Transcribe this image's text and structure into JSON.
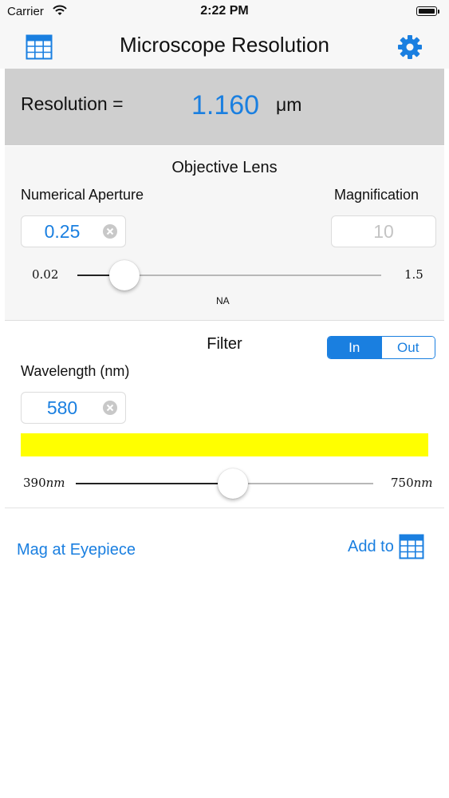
{
  "status_bar": {
    "carrier": "Carrier",
    "time": "2:22 PM",
    "battery_level": 1.0
  },
  "nav": {
    "title": "Microscope Resolution",
    "left_icon": "table-icon",
    "right_icon": "gear-icon"
  },
  "result": {
    "label": "Resolution =",
    "value": "1.160",
    "unit": "μm"
  },
  "objective_lens": {
    "title": "Objective Lens",
    "na_label": "Numerical Aperture",
    "na_value": "0.25",
    "magnification_label": "Magnification",
    "magnification_value": "10",
    "slider": {
      "min_label": "0.02",
      "max_label": "1.5",
      "caption": "NA",
      "min": 0.02,
      "max": 1.5,
      "value": 0.25
    }
  },
  "filter": {
    "title": "Filter",
    "segments": [
      "In",
      "Out"
    ],
    "selected_segment": "In",
    "wavelength_label": "Wavelength (nm)",
    "wavelength_value": "580",
    "swatch_color": "#ffff00",
    "slider": {
      "min_number": "390",
      "max_number": "750",
      "unit": "nm",
      "min": 390,
      "max": 750,
      "value": 580
    }
  },
  "bottom": {
    "mag_link": "Mag at Eyepiece",
    "add_to_label": "Add to",
    "add_to_icon": "table-icon"
  },
  "colors": {
    "accent": "#1a7fe0",
    "result_bg": "#cfcfcf",
    "section_bg": "#f6f6f6"
  }
}
